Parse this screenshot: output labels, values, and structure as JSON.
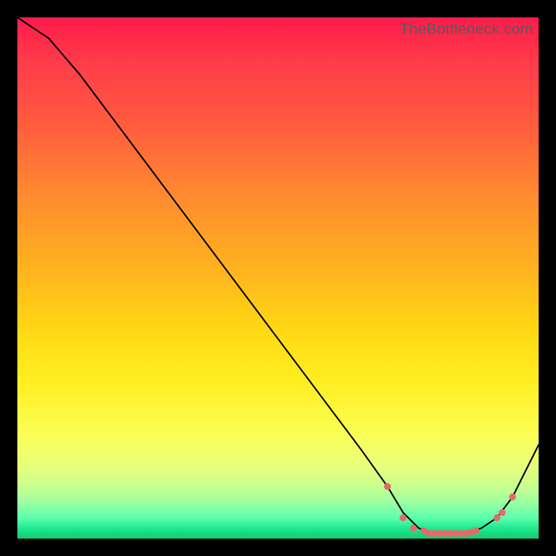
{
  "watermark": "TheBottleneck.com",
  "colors": {
    "dot": "#e46a6a",
    "curve": "#000000",
    "bg": "#000000"
  },
  "chart_data": {
    "type": "line",
    "title": "",
    "xlabel": "",
    "ylabel": "",
    "xlim": [
      0,
      100
    ],
    "ylim": [
      0,
      100
    ],
    "grid": false,
    "legend": false,
    "series": [
      {
        "name": "curve",
        "x": [
          0,
          6,
          12,
          18,
          24,
          30,
          36,
          42,
          48,
          54,
          60,
          66,
          71,
          74,
          77,
          80,
          83,
          86,
          89,
          92,
          95,
          98,
          100
        ],
        "y": [
          100,
          96,
          89,
          81,
          73,
          65,
          57,
          49,
          41,
          33,
          25,
          17,
          10,
          5,
          2,
          1,
          1,
          1,
          2,
          4,
          8,
          14,
          18
        ]
      }
    ],
    "markers": {
      "name": "dots",
      "x": [
        71,
        74,
        76,
        78,
        79,
        80,
        81,
        82,
        83,
        84,
        85,
        86,
        87,
        88,
        92,
        93,
        95
      ],
      "y": [
        10,
        4,
        2,
        1.5,
        1,
        1,
        1,
        1,
        1,
        1,
        1,
        1,
        1.2,
        1.5,
        4,
        5,
        8
      ]
    }
  }
}
